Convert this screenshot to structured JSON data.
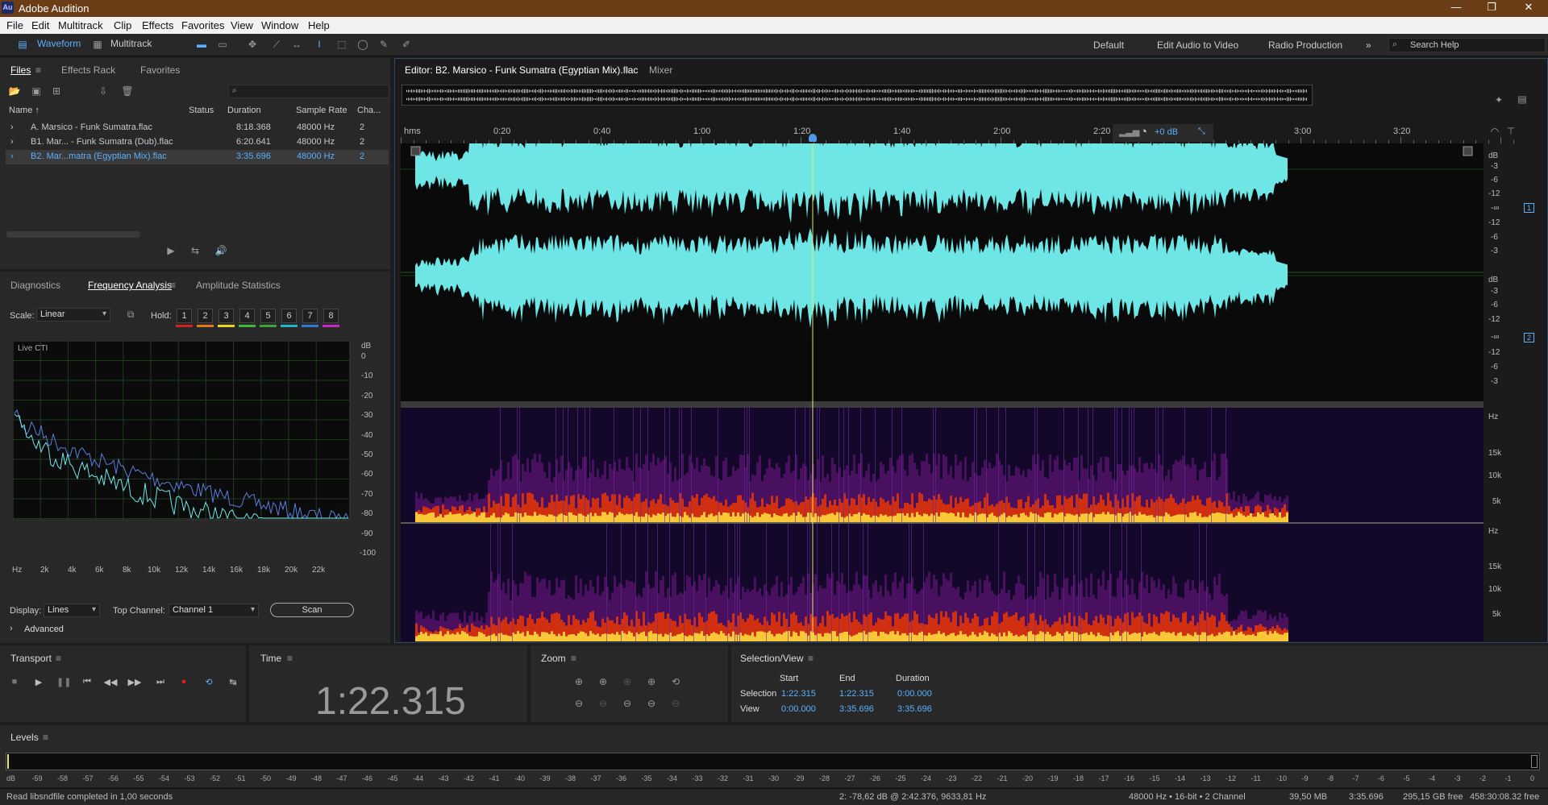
{
  "app": {
    "title": "Adobe Audition",
    "logo": "Au"
  },
  "menu": [
    "File",
    "Edit",
    "Multitrack",
    "Clip",
    "Effects",
    "Favorites",
    "View",
    "Window",
    "Help"
  ],
  "toolbar": {
    "waveform": "Waveform",
    "multitrack": "Multitrack",
    "workspaces": [
      "Default",
      "Edit Audio to Video",
      "Radio Production"
    ],
    "more": "»",
    "search_placeholder": "Search Help"
  },
  "files_panel": {
    "tabs": [
      "Files",
      "Effects Rack",
      "Favorites"
    ],
    "columns": [
      "Name ↑",
      "Status",
      "Duration",
      "Sample Rate",
      "Cha..."
    ],
    "rows": [
      {
        "name": "A. Marsico - Funk Sumatra.flac",
        "duration": "8:18.368",
        "rate": "48000 Hz",
        "ch": "2"
      },
      {
        "name": "B1. Mar... - Funk Sumatra (Dub).flac",
        "duration": "6:20.641",
        "rate": "48000 Hz",
        "ch": "2"
      },
      {
        "name": "B2. Mar...matra (Egyptian Mix).flac",
        "duration": "3:35.696",
        "rate": "48000 Hz",
        "ch": "2"
      }
    ]
  },
  "freq_panel": {
    "tabs": [
      "Diagnostics",
      "Frequency Analysis",
      "Amplitude Statistics"
    ],
    "scale_label": "Scale:",
    "scale_value": "Linear",
    "hold_label": "Hold:",
    "holds": [
      "1",
      "2",
      "3",
      "4",
      "5",
      "6",
      "7",
      "8"
    ],
    "hold_colors": [
      "#d42020",
      "#e07a18",
      "#e8d41c",
      "#3cb83c",
      "#38a838",
      "#1fb8c8",
      "#2b7ad8",
      "#c828c8"
    ],
    "live": "Live CTI",
    "db_unit": "dB",
    "db_ticks": [
      "0",
      "-10",
      "-20",
      "-30",
      "-40",
      "-50",
      "-60",
      "-70",
      "-80",
      "-90",
      "-100"
    ],
    "hz_ticks": [
      "Hz",
      "2k",
      "4k",
      "6k",
      "8k",
      "10k",
      "12k",
      "14k",
      "16k",
      "18k",
      "20k",
      "22k"
    ],
    "display_label": "Display:",
    "display_value": "Lines",
    "top_channel_label": "Top Channel:",
    "top_channel_value": "Channel 1",
    "scan": "Scan",
    "advanced": "Advanced"
  },
  "editor": {
    "tab": "Editor: B2. Marsico - Funk Sumatra (Egyptian Mix).flac",
    "mixer": "Mixer",
    "ruler": [
      "hms",
      "0:20",
      "0:40",
      "1:00",
      "1:20",
      "1:40",
      "2:00",
      "2:20",
      "3:00",
      "3:20"
    ],
    "volume": "+0 dB",
    "db_unit": "dB",
    "db_ticks_ch": [
      "-3",
      "-6",
      "-12",
      "-∞",
      "-12",
      "-6",
      "-3"
    ],
    "channel_badges": [
      "1",
      "2"
    ],
    "hz_unit": "Hz",
    "hz_ticks": [
      "15k",
      "10k",
      "5k"
    ],
    "colors": {
      "wave": "#6ee6e6",
      "cursor": "#e8e85a",
      "selection_border": "#2c4a6a"
    }
  },
  "transport": {
    "title": "Transport",
    "buttons": [
      "stop",
      "play",
      "pause",
      "to-start",
      "rewind",
      "fast-forward",
      "to-end",
      "record",
      "loop",
      "skip"
    ]
  },
  "time_panel": {
    "title": "Time",
    "value": "1:22.315"
  },
  "zoom_panel": {
    "title": "Zoom"
  },
  "selection_view": {
    "title": "Selection/View",
    "headers": [
      "Start",
      "End",
      "Duration"
    ],
    "rows": [
      {
        "label": "Selection",
        "start": "1:22.315",
        "end": "1:22.315",
        "duration": "0:00.000"
      },
      {
        "label": "View",
        "start": "0:00.000",
        "end": "3:35.696",
        "duration": "3:35.696"
      }
    ]
  },
  "levels": {
    "title": "Levels",
    "ticks": [
      "dB",
      "-59",
      "-58",
      "-57",
      "-56",
      "-55",
      "-54",
      "-53",
      "-52",
      "-51",
      "-50",
      "-49",
      "-48",
      "-47",
      "-46",
      "-45",
      "-44",
      "-43",
      "-42",
      "-41",
      "-40",
      "-39",
      "-38",
      "-37",
      "-36",
      "-35",
      "-34",
      "-33",
      "-32",
      "-31",
      "-30",
      "-29",
      "-28",
      "-27",
      "-26",
      "-25",
      "-24",
      "-23",
      "-22",
      "-21",
      "-20",
      "-19",
      "-18",
      "-17",
      "-16",
      "-15",
      "-14",
      "-13",
      "-12",
      "-11",
      "-10",
      "-9",
      "-8",
      "-7",
      "-6",
      "-5",
      "-4",
      "-3",
      "-2",
      "-1",
      "0"
    ]
  },
  "status": {
    "left": "Read libsndfile completed in 1,00 seconds",
    "cursor": "2: -78,62 dB @ 2:42.376, 9633,81 Hz",
    "format": "48000 Hz • 16-bit • 2 Channel",
    "size": "39,50 MB",
    "length": "3:35.696",
    "free": "295,15 GB free",
    "free_time": "458:30:08.32 free"
  }
}
